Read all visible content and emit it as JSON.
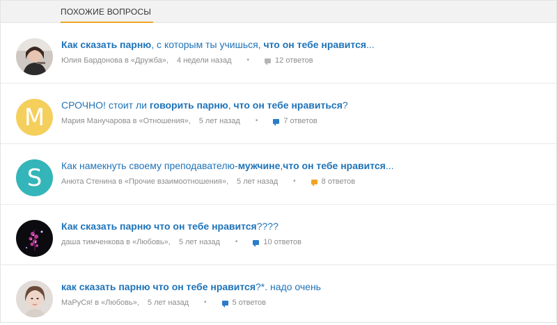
{
  "section": {
    "title": "ПОХОЖИЕ ВОПРОСЫ"
  },
  "colors": {
    "accent": "#f0a526",
    "link": "#1e73b8",
    "meta": "#8c8c8c"
  },
  "questions": [
    {
      "title_parts": [
        {
          "t": "Как сказать парню",
          "b": true
        },
        {
          "t": ", с которым ты учишься, ",
          "b": false
        },
        {
          "t": "что он тебе нравится",
          "b": true
        },
        {
          "t": "...",
          "b": false
        }
      ],
      "author": "Юлия Бардонова в «Дружба»,",
      "time": "4 недели назад",
      "answers": "12 ответов",
      "answer_icon": "gray",
      "avatar": {
        "type": "photo",
        "icon": "girl-photo-avatar"
      }
    },
    {
      "title_parts": [
        {
          "t": "СРОЧНО! стоит ли ",
          "b": false
        },
        {
          "t": "говорить парню",
          "b": true
        },
        {
          "t": ", ",
          "b": false
        },
        {
          "t": "что он тебе нравиться",
          "b": true
        },
        {
          "t": "?",
          "b": false
        }
      ],
      "author": "Мария Манучарова в «Отношения»,",
      "time": "5 лет назад",
      "answers": "7 ответов",
      "answer_icon": "blue",
      "avatar": {
        "type": "letter",
        "letter": "M",
        "color": "#f5cf5c"
      }
    },
    {
      "title_parts": [
        {
          "t": "Как намекнуть своему преподавателю-",
          "b": false
        },
        {
          "t": "мужчине",
          "b": true
        },
        {
          "t": ",",
          "b": false
        },
        {
          "t": "что он тебе нравится",
          "b": true
        },
        {
          "t": "...",
          "b": false
        }
      ],
      "author": "Анюта Стенина в «Прочие взаимоотношения»,",
      "time": "5 лет назад",
      "answers": "8 ответов",
      "answer_icon": "orange",
      "avatar": {
        "type": "letter",
        "letter": "S",
        "color": "#34b5b9"
      }
    },
    {
      "title_parts": [
        {
          "t": "Как сказать парню что он тебе нравится",
          "b": true
        },
        {
          "t": "????",
          "b": false
        }
      ],
      "author": "даша тимченкова в «Любовь»,",
      "time": "5 лет назад",
      "answers": "10 ответов",
      "answer_icon": "blue",
      "avatar": {
        "type": "photo",
        "icon": "flower-photo-avatar"
      }
    },
    {
      "title_parts": [
        {
          "t": "как сказать парню что он тебе нравится",
          "b": true
        },
        {
          "t": "?*. надо очень",
          "b": false
        }
      ],
      "author": "МаРуСя! в «Любовь»,",
      "time": "5 лет назад",
      "answers": "5 ответов",
      "answer_icon": "blue",
      "avatar": {
        "type": "photo",
        "icon": "portrait-photo-avatar"
      }
    }
  ]
}
